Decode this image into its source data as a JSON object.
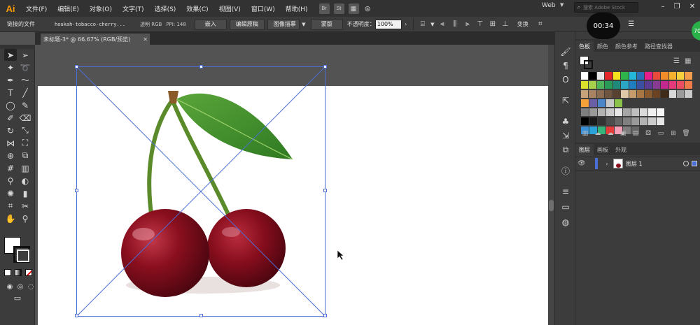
{
  "app": {
    "logo": "Ai",
    "menus": [
      "文件(F)",
      "编辑(E)",
      "对象(O)",
      "文字(T)",
      "选择(S)",
      "效果(C)",
      "视图(V)",
      "窗口(W)",
      "帮助(H)"
    ],
    "bridge_badge": "Br",
    "stock_badge": "St",
    "workspace": "Web",
    "stock_search_placeholder": "搜索 Adobe Stock",
    "recording_timer": "00:34",
    "green_badge": "70"
  },
  "control_bar": {
    "linked_file_label": "链接的文件",
    "file_name": "hookah-tobacco-cherry...",
    "color_mode": "透明 RGB",
    "ppi": "PPI: 148",
    "embed_label": "嵌入",
    "edit_original_label": "编辑原稿",
    "image_trace_label": "图像描摹",
    "mask_label": "蒙版",
    "opacity_label": "不透明度：",
    "opacity_value": "100%",
    "transform_label": "变换"
  },
  "document": {
    "tab_title": "未标题-3* @ 66.67% (RGB/预览)"
  },
  "swatches_panel": {
    "tabs": [
      "色板",
      "颜色",
      "颜色参考",
      "路径查找器"
    ],
    "rows": [
      [
        "#ffffff",
        "#000000",
        "#e6e6e6",
        "#e3262a",
        "#f5e11c",
        "#2db44a",
        "#23b8d9",
        "#2a6fb8",
        "#e61e8c",
        "#e84b3c",
        "#f28c28",
        "#f6b12f",
        "#f7d03e",
        "#f39c4c"
      ],
      [
        "#dce22c",
        "#a7d04b",
        "#4db65c",
        "#2a9a58",
        "#1d8a7a",
        "#2aa7c4",
        "#1f7ec0",
        "#3b4fa3",
        "#5c3c92",
        "#893a92",
        "#c2288e",
        "#e4397a",
        "#ea4d61",
        "#f07b4a"
      ],
      [
        "#c8a27a",
        "#a88363",
        "#8b6b51",
        "#6f543f",
        "#58412f",
        "#e0c9a6",
        "#c79c6b",
        "#a87745",
        "#8a5a2e",
        "#6b4322",
        "#3e2b1a",
        "#d9d9d9",
        "#9a9a9a",
        "#c9c9c9"
      ],
      [
        "#f4a13a",
        "#6a5fa6",
        "#4a86c8",
        "#c7c7c7",
        "#8bc34a"
      ],
      [
        "#7f7f7f",
        "#999999",
        "#b3b3b3",
        "#cccccc",
        "#e6e6e6",
        "#a6a6a6",
        "#bfbfbf",
        "#d9d9d9",
        "#efefef",
        "#f7f7f7"
      ],
      [
        "#000000",
        "#1a1a1a",
        "#333333",
        "#4d4d4d",
        "#666666",
        "#808080",
        "#999999",
        "#b3b3b3",
        "#cccccc",
        "#e6e6e6"
      ],
      [
        "#3a8fd6",
        "#2ba3d8",
        "#34b47a",
        "#e53b3b",
        "#f5a0b8",
        "#7f7f7f",
        "#666666"
      ]
    ]
  },
  "layers_panel": {
    "tabs": [
      "图层",
      "画板",
      "外观"
    ],
    "layer_name": "图层 1"
  },
  "icons": {
    "dock": [
      "brush-icon",
      "paragraph-icon",
      "glyph-o-icon",
      "export-icon",
      "club-icon",
      "asset-icon",
      "link-icon",
      "info-icon",
      "align-icon",
      "gradient-icon",
      "transparency-icon"
    ]
  }
}
